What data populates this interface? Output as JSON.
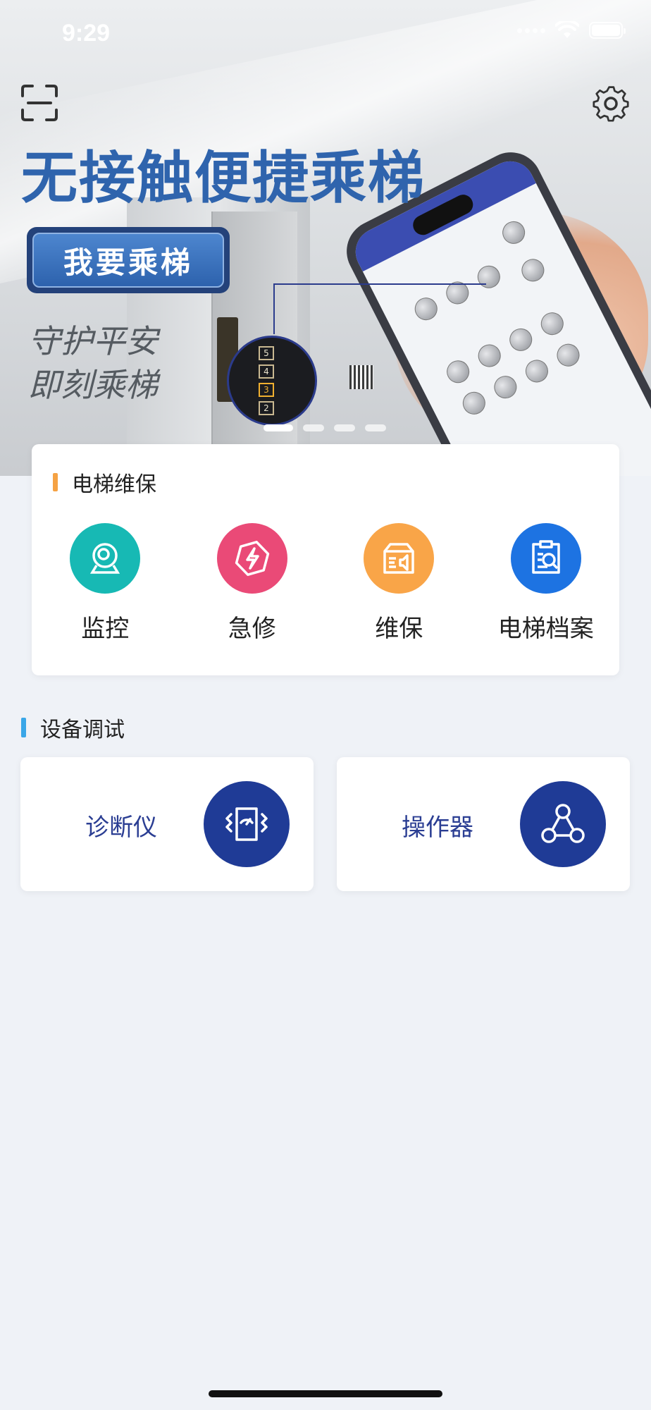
{
  "status_bar": {
    "time": "9:29"
  },
  "hero": {
    "title": "无接触便捷乘梯",
    "ride_button": "我要乘梯",
    "slogan_line1": "守护平安",
    "slogan_line2": "即刻乘梯",
    "carousel_active_index": 0,
    "carousel_count": 4,
    "floor_buttons": [
      "5",
      "4",
      "3",
      "2"
    ]
  },
  "maintenance": {
    "title": "电梯维保",
    "accent_color": "#f5a244",
    "items": [
      {
        "label": "监控",
        "icon": "camera-icon",
        "color": "#17b9b4"
      },
      {
        "label": "急修",
        "icon": "lightning-icon",
        "color": "#ea4a77"
      },
      {
        "label": "维保",
        "icon": "speaker-box-icon",
        "color": "#f9a548"
      },
      {
        "label": "电梯档案",
        "icon": "document-search-icon",
        "color": "#1d73e2"
      }
    ]
  },
  "debug": {
    "title": "设备调试",
    "accent_color": "#3aa7e8",
    "tools": [
      {
        "label": "诊断仪",
        "icon": "diagnostic-icon"
      },
      {
        "label": "操作器",
        "icon": "network-icon"
      }
    ]
  }
}
